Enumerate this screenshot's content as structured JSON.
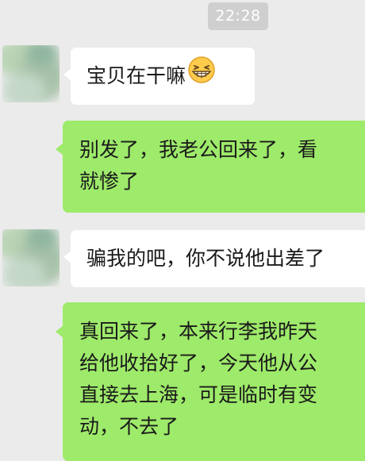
{
  "chat": {
    "timestamp": "22:28",
    "messages": [
      {
        "side": "incoming",
        "text": "宝贝在干嘛",
        "emoji": "grinning-face-icon"
      },
      {
        "side": "outgoing",
        "lines": [
          "别发了，我老公回来了，看",
          "就惨了"
        ]
      },
      {
        "side": "incoming",
        "text": "骗我的吧，你不说他出差了"
      },
      {
        "side": "outgoing",
        "lines": [
          "真回来了，本来行李我昨天",
          "给他收拾好了，今天他从公",
          "直接去上海，可是临时有变",
          "动，不去了"
        ]
      }
    ]
  },
  "colors": {
    "background": "#ebebeb",
    "incoming_bubble": "#ffffff",
    "outgoing_bubble": "#9eea6a",
    "timestamp_bg": "#cfcfcf"
  }
}
